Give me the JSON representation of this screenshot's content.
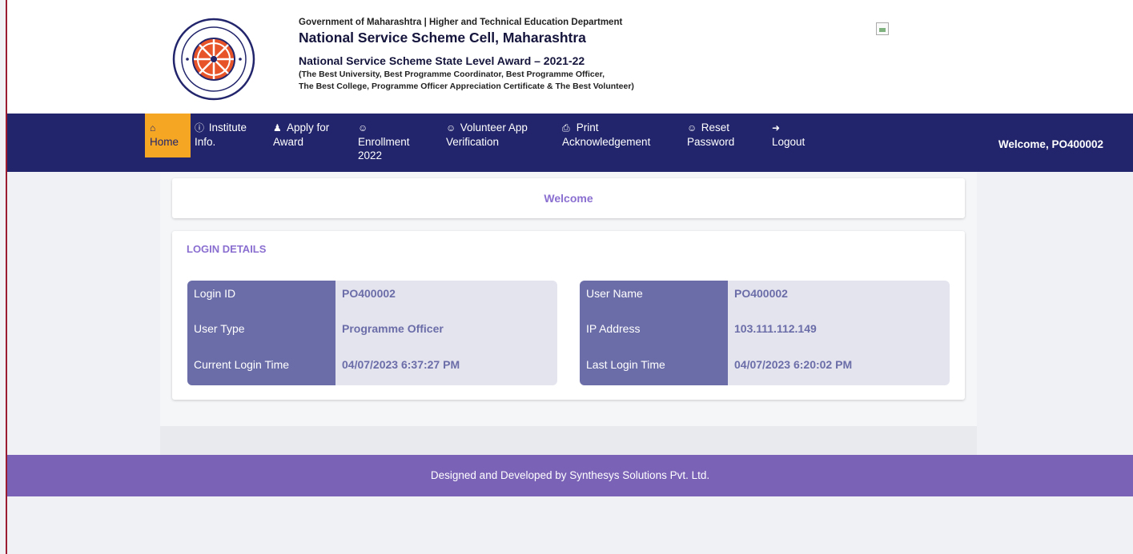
{
  "header": {
    "gov_line": "Government of Maharashtra | Higher and Technical Education Department",
    "cell_title": "National Service Scheme Cell, Maharashtra",
    "award_title": "National Service Scheme State Level Award – 2021-22",
    "award_sub_1": "(The Best University, Best Programme Coordinator, Best Programme Officer,",
    "award_sub_2": "The Best College, Programme Officer Appreciation Certificate & The Best Volunteer)"
  },
  "nav": {
    "home": {
      "line1": "",
      "line2": "Home",
      "icon": "home-icon"
    },
    "institute": {
      "line1": "Institute",
      "line2": "Info.",
      "icon": "info-icon"
    },
    "apply": {
      "line1": "Apply for",
      "line2": "Award",
      "icon": "trophy-icon"
    },
    "enrollment": {
      "line1": "",
      "line2": "Enrollment",
      "line3": "2022",
      "icon": "user-check-icon"
    },
    "volunteer": {
      "line1": "Volunteer App",
      "line2": "Verification",
      "icon": "user-check-icon"
    },
    "print": {
      "line1": "Print",
      "line2": "Acknowledgement",
      "icon": "print-icon"
    },
    "reset": {
      "line1": "Reset",
      "line2": "Password",
      "icon": "user-check-icon"
    },
    "logout": {
      "line1": "",
      "line2": "Logout",
      "icon": "sign-in-icon"
    },
    "welcome_user": "Welcome, PO400002"
  },
  "welcome_card": {
    "title": "Welcome"
  },
  "login_details": {
    "heading": "LOGIN DETAILS",
    "left": [
      {
        "label": "Login ID",
        "value": "PO400002"
      },
      {
        "label": "User Type",
        "value": "Programme Officer"
      },
      {
        "label": "Current Login Time",
        "value": "04/07/2023 6:37:27 PM"
      }
    ],
    "right": [
      {
        "label": "User Name",
        "value": "PO400002"
      },
      {
        "label": "IP Address",
        "value": "103.111.112.149"
      },
      {
        "label": "Last Login Time",
        "value": "04/07/2023 6:20:02 PM"
      }
    ]
  },
  "footer": {
    "text": "Designed and Developed by Synthesys Solutions Pvt. Ltd."
  },
  "colors": {
    "navbar": "#22256b",
    "active_tab": "#f5a623",
    "accent": "#8a6fd1",
    "label_bg": "#6b6da8",
    "footer": "#7a62b6"
  }
}
